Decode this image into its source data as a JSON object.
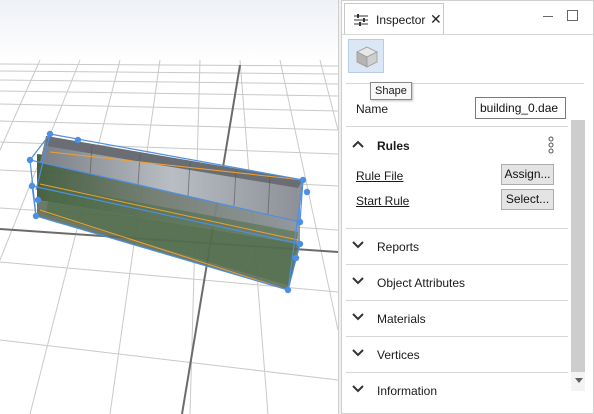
{
  "inspector": {
    "tab_label": "Inspector",
    "shape_tooltip": "Shape",
    "name_label": "Name",
    "name_value": "building_0.dae",
    "rules": {
      "header": "Rules",
      "rule_file_label": "Rule File",
      "assign_button": "Assign...",
      "start_rule_label": "Start Rule",
      "select_button": "Select..."
    },
    "sections": [
      "Reports",
      "Object Attributes",
      "Materials",
      "Vertices",
      "Information"
    ]
  },
  "icons": {
    "tab": "sliders-icon",
    "close": "close-icon",
    "minimize": "minimize-icon",
    "maximize": "maximize-icon",
    "shape": "cube-icon",
    "expand": "chevron-up-icon",
    "collapsed": "chevron-down-icon",
    "more": "kebab-menu-icon"
  },
  "colors": {
    "selection_handle": "#4d8fe0",
    "selection_edge": "#f0a030",
    "selected_button_bg": "#dbe7f4"
  }
}
